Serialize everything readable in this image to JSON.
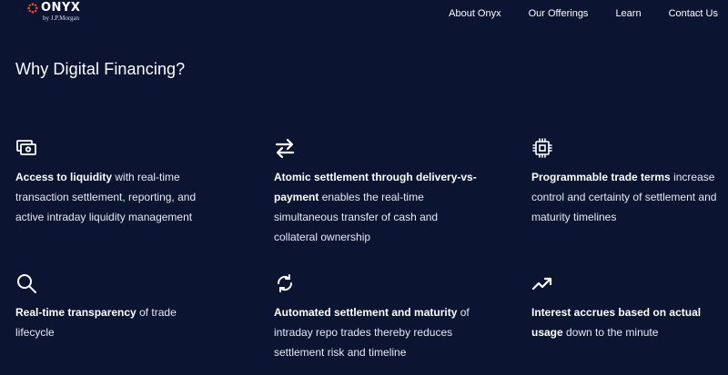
{
  "brand": {
    "name": "ONYX",
    "tagline": "by J.P.Morgan",
    "accent_color": "#e8462c"
  },
  "nav": {
    "items": [
      "About Onyx",
      "Our Offerings",
      "Learn",
      "Contact Us"
    ]
  },
  "section": {
    "title": "Why Digital Financing?"
  },
  "features": [
    {
      "icon": "cash-icon",
      "bold": "Access to liquidity",
      "text": " with real-time transaction settlement, reporting, and active intraday liquidity management"
    },
    {
      "icon": "transfer-arrows-icon",
      "bold": "Atomic settlement through delivery-vs-payment",
      "text": " enables the real-time simultaneous transfer of cash and collateral ownership"
    },
    {
      "icon": "chip-icon",
      "bold": "Programmable trade terms",
      "text": " increase control and certainty of settlement and maturity timelines"
    },
    {
      "icon": "search-icon",
      "bold": "Real-time transparency",
      "text": " of trade lifecycle"
    },
    {
      "icon": "refresh-icon",
      "bold": "Automated settlement and maturity",
      "text": " of intraday repo trades thereby reduces settlement risk and timeline"
    },
    {
      "icon": "trending-up-icon",
      "bold": "Interest accrues based on actual usage",
      "text": " down to the minute"
    }
  ],
  "colors": {
    "background": "#0b1430",
    "text": "#ffffff"
  }
}
